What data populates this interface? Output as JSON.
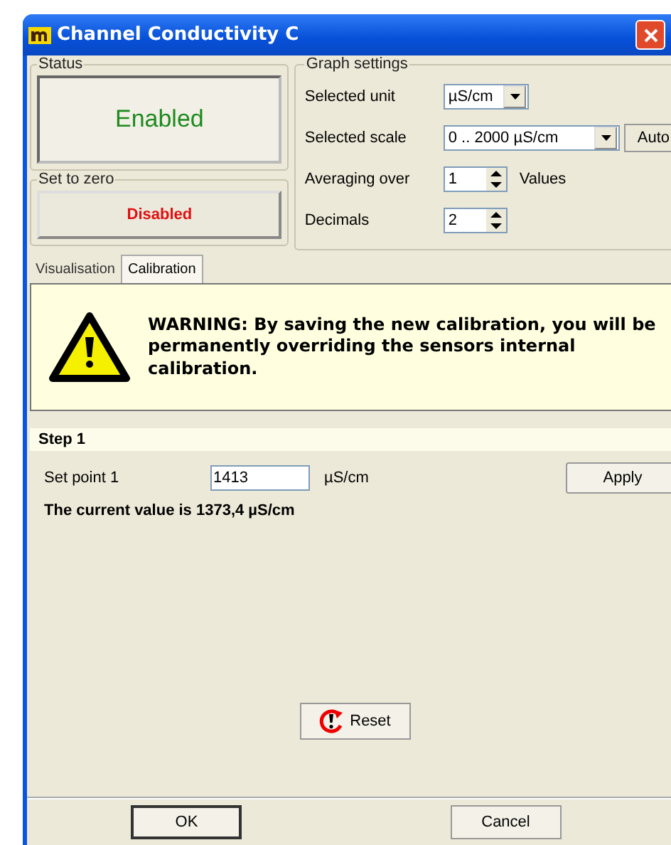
{
  "window": {
    "title": "Channel Conductivity C"
  },
  "status": {
    "label": "Status",
    "value": "Enabled",
    "enabled": true
  },
  "set_to_zero": {
    "label": "Set to zero",
    "value": "Disabled",
    "enabled": false
  },
  "graph_settings": {
    "label": "Graph settings",
    "rows": [
      {
        "kind": "select",
        "label": "Selected unit",
        "value": "µS/cm"
      },
      {
        "kind": "select_button",
        "label": "Selected scale",
        "value": "0 .. 2000 µS/cm",
        "button": "Auto"
      },
      {
        "kind": "spinner",
        "label": "Averaging over",
        "value": "1",
        "suffix": "Values"
      },
      {
        "kind": "spinner",
        "label": "Decimals",
        "value": "2"
      }
    ]
  },
  "tabs": [
    {
      "label": "Visualisation",
      "selected": false
    },
    {
      "label": "Calibration",
      "selected": true
    }
  ],
  "warning": {
    "text": "WARNING: By saving the new calibration, you will be permanently overriding the sensors internal calibration."
  },
  "step": {
    "title": "Step 1",
    "setpoint_label": "Set point 1",
    "setpoint_value": "1413",
    "unit": "µS/cm",
    "apply": "Apply",
    "current": "The current value is 1373,4 µS/cm"
  },
  "reset": "Reset",
  "buttons": [
    "OK",
    "Cancel"
  ]
}
